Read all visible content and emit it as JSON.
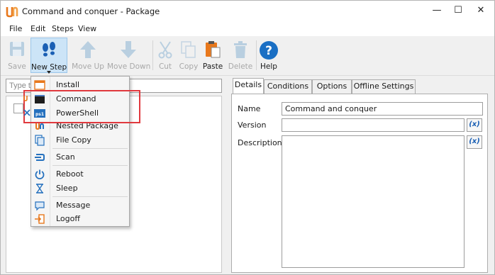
{
  "window": {
    "title": "Command and conquer - Package",
    "controls": [
      "—",
      "☐",
      "✕"
    ]
  },
  "menu": [
    "File",
    "Edit",
    "Steps",
    "View"
  ],
  "toolbar": {
    "save": "Save",
    "new_step": "New Step",
    "move_up": "Move Up",
    "move_down": "Move Down",
    "cut": "Cut",
    "copy": "Copy",
    "paste": "Paste",
    "delete": "Delete",
    "help": "Help"
  },
  "search": {
    "placeholder": "Type t"
  },
  "dropdown": {
    "items": [
      {
        "label": "Install",
        "icon": "install-icon"
      },
      {
        "label": "Command",
        "icon": "command-icon"
      },
      {
        "label": "PowerShell",
        "icon": "powershell-icon"
      },
      {
        "label": "Nested Package",
        "icon": "nested-package-icon"
      },
      {
        "label": "File Copy",
        "icon": "file-copy-icon"
      },
      {
        "label": "Scan",
        "icon": "scan-icon"
      },
      {
        "label": "Reboot",
        "icon": "reboot-icon"
      },
      {
        "label": "Sleep",
        "icon": "sleep-icon"
      },
      {
        "label": "Message",
        "icon": "message-icon"
      },
      {
        "label": "Logoff",
        "icon": "logoff-icon"
      }
    ]
  },
  "tabs": [
    "Details",
    "Conditions",
    "Options",
    "Offline Settings"
  ],
  "details": {
    "name_label": "Name",
    "name_value": "Command and conquer",
    "version_label": "Version",
    "version_value": "",
    "description_label": "Description",
    "description_value": "",
    "var_button": "(x)"
  },
  "colors": {
    "highlight": "#e0393e",
    "accent_blue": "#1a5fb4",
    "orange": "#e8781c"
  }
}
